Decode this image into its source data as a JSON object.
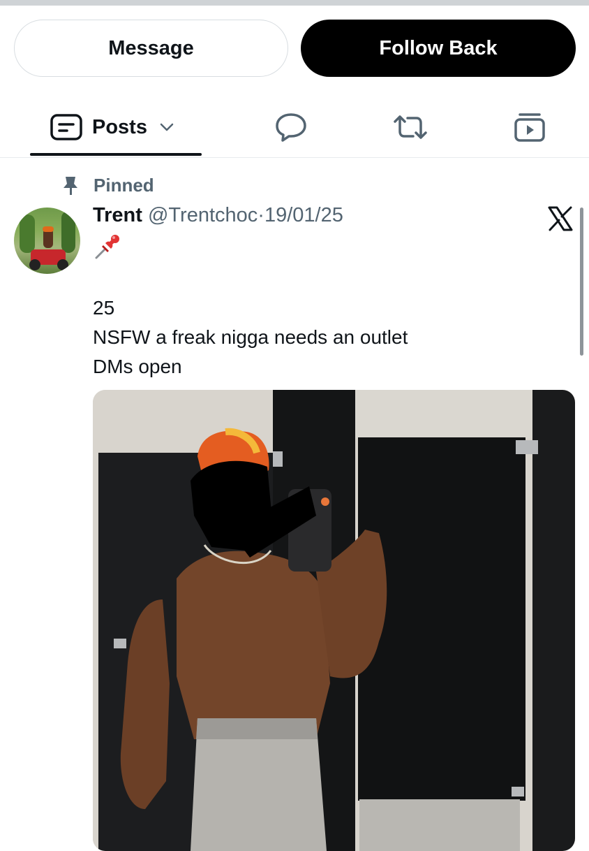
{
  "profile_actions": {
    "message_label": "Message",
    "follow_label": "Follow Back"
  },
  "tabs": {
    "posts_label": "Posts",
    "icons": [
      "posts-icon",
      "chevron-down-icon",
      "reply-bubble-icon",
      "repost-icon",
      "media-play-icon"
    ]
  },
  "post": {
    "pinned_label": "Pinned",
    "author_name": "Trent",
    "author_handle": "@Trentchoc",
    "separator": "·",
    "date": "19/01/25",
    "emoji": "📌",
    "text_lines": [
      "25",
      "NSFW a freak nigga needs an outlet",
      "DMs open"
    ],
    "source_icon": "x-logo-icon",
    "image_description_icon": "photo"
  },
  "colors": {
    "primary_text": "#0f1419",
    "secondary_text": "#536471",
    "follow_button_bg": "#000000",
    "divider": "#e8ebee"
  }
}
